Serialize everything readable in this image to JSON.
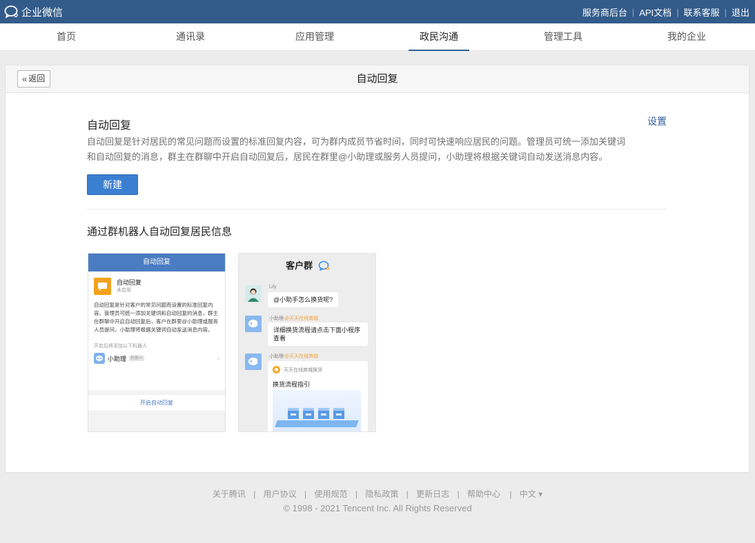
{
  "topbar": {
    "logo_text": "企业微信",
    "links": [
      "服务商后台",
      "API文档",
      "联系客服",
      "退出"
    ]
  },
  "nav": {
    "items": [
      {
        "label": "首页"
      },
      {
        "label": "通讯录"
      },
      {
        "label": "应用管理"
      },
      {
        "label": "政民沟通",
        "active": true
      },
      {
        "label": "管理工具"
      },
      {
        "label": "我的企业"
      }
    ]
  },
  "page": {
    "back_label": "返回",
    "title": "自动回复",
    "section_title": "自动回复",
    "settings_label": "设置",
    "description": "自动回复是针对居民的常见问题而设置的标准回复内容，可为群内成员节省时间，同时可快速响应居民的问题。管理员可统一添加关键词和自动回复的消息，群主在群聊中开启自动回复后，居民在群里@小助理或服务人员提问，小助理将根据关键词自动发送消息内容。",
    "new_button": "新建",
    "sub_title": "通过群机器人自动回复居民信息"
  },
  "preview_left": {
    "header": "自动回复",
    "app_name": "自动回复",
    "app_status": "未启用",
    "description": "自动回复是针对客户的常见问题而设置的标准回复内容。管理员可统一添加关键词和自动回复的消息，群主在群聊中开启自动回复后，客户在群里@小助理或服务人员提问，小助理将根据关键词自动发送消息内容。",
    "robot_hint": "开启后将添加以下机器人",
    "robot_name": "小助理",
    "robot_tag": "机器人",
    "footer_button": "开启自动回复"
  },
  "preview_right": {
    "title": "客户群",
    "messages": [
      {
        "sender": "Lily",
        "text": "@小助手怎么换货呢?"
      },
      {
        "sender": "小助理",
        "org": "@天天在线商城",
        "text": "详细换货流程请点击下面小程序查看"
      },
      {
        "sender": "小助理",
        "org": "@天天在线商城",
        "card_source": "天天在线商城换货",
        "card_title": "换货流程指引"
      }
    ]
  },
  "footer": {
    "links": [
      "关于腾讯",
      "用户协议",
      "使用规范",
      "隐私政策",
      "更新日志",
      "帮助中心"
    ],
    "language": "中文 ▾",
    "copyright": "© 1998 - 2021 Tencent Inc. All Rights Reserved"
  },
  "colors": {
    "topbar": "#335b8a",
    "primary_button": "#3b7fd1",
    "link": "#2f5f99",
    "robot_org": "#f0a23a"
  },
  "icons": {
    "logo": "wecom-chat-bubble-icon",
    "back": "double-chevron-left-icon",
    "app": "message-icon",
    "robot": "robot-icon",
    "group": "chat-bubble-icon",
    "card_source": "store-icon"
  }
}
